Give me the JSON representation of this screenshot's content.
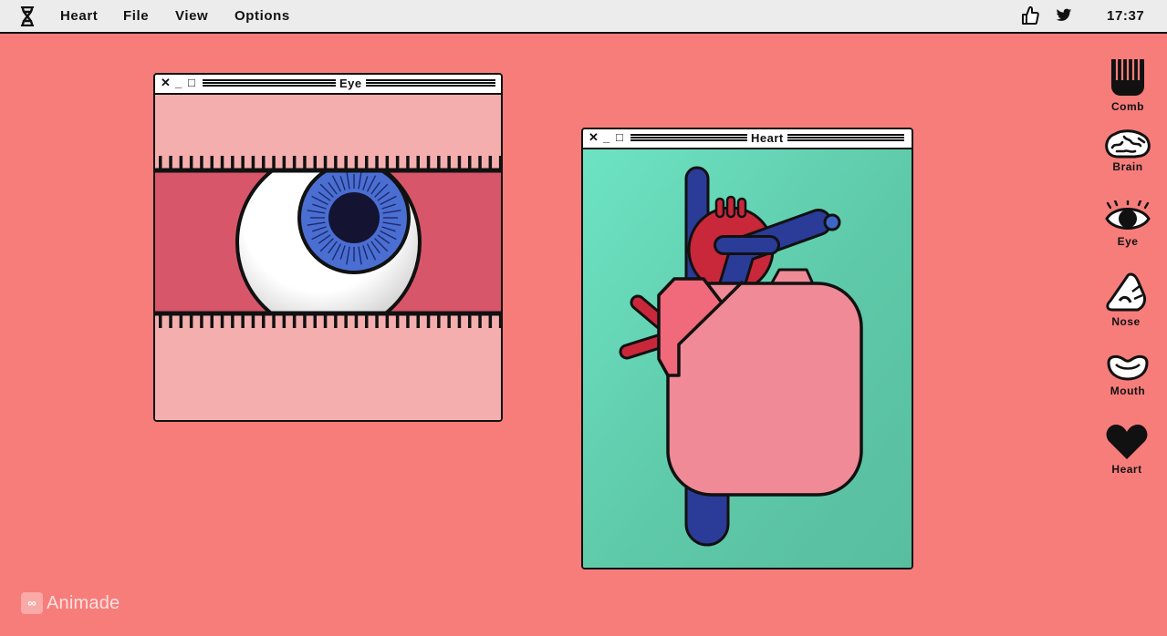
{
  "menubar": {
    "logo_icon": "dna-icon",
    "menus": [
      "Heart",
      "File",
      "View",
      "Options"
    ],
    "like_icon": "thumbs-up-icon",
    "twitter_icon": "twitter-icon",
    "time": "17:37"
  },
  "windows": {
    "eye": {
      "title": "Eye",
      "close": "✕",
      "minimize": "_",
      "maximize": "□"
    },
    "heart": {
      "title": "Heart",
      "close": "✕",
      "minimize": "_",
      "maximize": "□"
    }
  },
  "dock": {
    "items": [
      {
        "label": "Comb",
        "icon": "comb-icon"
      },
      {
        "label": "Brain",
        "icon": "brain-icon"
      },
      {
        "label": "Eye",
        "icon": "eye-icon"
      },
      {
        "label": "Nose",
        "icon": "nose-icon"
      },
      {
        "label": "Mouth",
        "icon": "mouth-icon"
      },
      {
        "label": "Heart",
        "icon": "heart-icon"
      }
    ]
  },
  "brand": {
    "icon": "∞",
    "name": "Animade"
  },
  "colors": {
    "background": "#f77d7b",
    "menubar": "#ececec",
    "eye_skin": "#f5aeae",
    "eye_socket": "#d8566a",
    "iris": "#4a6ed2",
    "heart_bg": "#5ec9a8",
    "heart_body": "#f08a96",
    "artery_red": "#c8283a",
    "vein_blue": "#2b3b98"
  }
}
